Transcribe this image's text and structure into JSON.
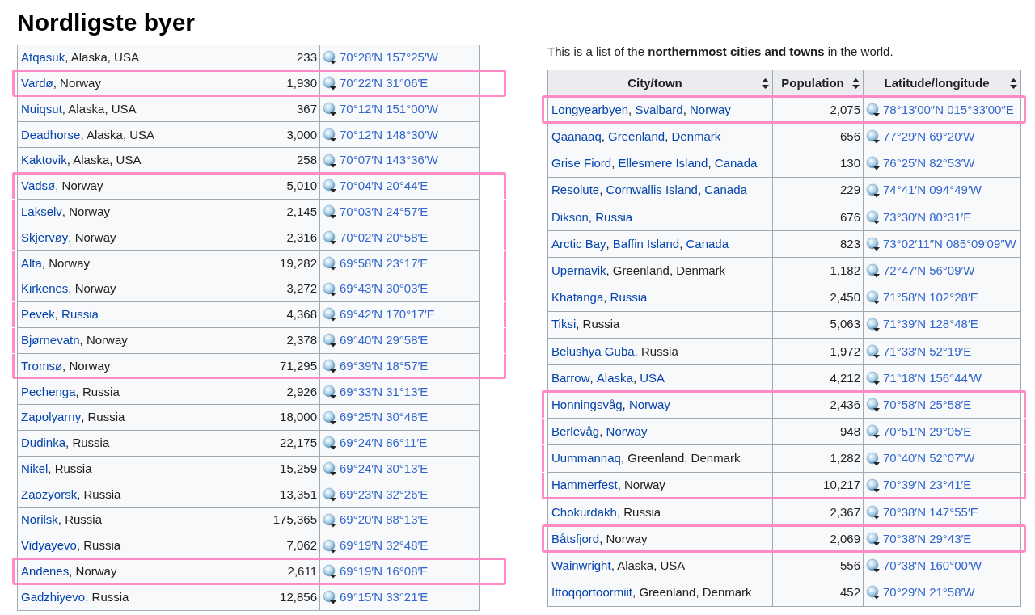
{
  "title": "Nordligste byer",
  "intro": "This is a list of the **northernmost cities and towns** in the world.",
  "tables": [
    {
      "rows": [
        {
          "place": [
            {
              "text": "Atqasuk",
              "link": true
            },
            {
              "text": ", Alaska, USA",
              "link": false
            }
          ],
          "population": "233",
          "coordinates": "70°28′N 157°25′W",
          "highlighted": false
        },
        {
          "place": [
            {
              "text": "Vardø",
              "link": true
            },
            {
              "text": ", Norway",
              "link": false
            }
          ],
          "population": "1,930",
          "coordinates": "70°22′N 31°06′E",
          "highlighted": true
        },
        {
          "place": [
            {
              "text": "Nuiqsut",
              "link": true
            },
            {
              "text": ", Alaska, USA",
              "link": false
            }
          ],
          "population": "367",
          "coordinates": "70°12′N 151°00′W",
          "highlighted": false
        },
        {
          "place": [
            {
              "text": "Deadhorse",
              "link": true
            },
            {
              "text": ", Alaska, USA",
              "link": false
            }
          ],
          "population": "3,000",
          "coordinates": "70°12′N 148°30′W",
          "highlighted": false
        },
        {
          "place": [
            {
              "text": "Kaktovik",
              "link": true
            },
            {
              "text": ", Alaska, USA",
              "link": false
            }
          ],
          "population": "258",
          "coordinates": "70°07′N 143°36′W",
          "highlighted": false
        },
        {
          "place": [
            {
              "text": "Vadsø",
              "link": true
            },
            {
              "text": ", Norway",
              "link": false
            }
          ],
          "population": "5,010",
          "coordinates": "70°04′N 20°44′E",
          "highlighted": true
        },
        {
          "place": [
            {
              "text": "Lakselv",
              "link": true
            },
            {
              "text": ", Norway",
              "link": false
            }
          ],
          "population": "2,145",
          "coordinates": "70°03′N 24°57′E",
          "highlighted": true
        },
        {
          "place": [
            {
              "text": "Skjervøy",
              "link": true
            },
            {
              "text": ", Norway",
              "link": false
            }
          ],
          "population": "2,316",
          "coordinates": "70°02′N 20°58′E",
          "highlighted": true
        },
        {
          "place": [
            {
              "text": "Alta",
              "link": true
            },
            {
              "text": ", Norway",
              "link": false
            }
          ],
          "population": "19,282",
          "coordinates": "69°58′N 23°17′E",
          "highlighted": true
        },
        {
          "place": [
            {
              "text": "Kirkenes",
              "link": true
            },
            {
              "text": ", Norway",
              "link": false
            }
          ],
          "population": "3,272",
          "coordinates": "69°43′N 30°03′E",
          "highlighted": true
        },
        {
          "place": [
            {
              "text": "Pevek",
              "link": true
            },
            {
              "text": ", ",
              "link": false
            },
            {
              "text": "Russia",
              "link": true
            }
          ],
          "population": "4,368",
          "coordinates": "69°42′N 170°17′E",
          "highlighted": true
        },
        {
          "place": [
            {
              "text": "Bjørnevatn",
              "link": true
            },
            {
              "text": ", Norway",
              "link": false
            }
          ],
          "population": "2,378",
          "coordinates": "69°40′N 29°58′E",
          "highlighted": true
        },
        {
          "place": [
            {
              "text": "Tromsø",
              "link": true
            },
            {
              "text": ", Norway",
              "link": false
            }
          ],
          "population": "71,295",
          "coordinates": "69°39′N 18°57′E",
          "highlighted": true
        },
        {
          "place": [
            {
              "text": "Pechenga",
              "link": true
            },
            {
              "text": ", Russia",
              "link": false
            }
          ],
          "population": "2,926",
          "coordinates": "69°33′N 31°13′E",
          "highlighted": false
        },
        {
          "place": [
            {
              "text": "Zapolyarny",
              "link": true
            },
            {
              "text": ", Russia",
              "link": false
            }
          ],
          "population": "18,000",
          "coordinates": "69°25′N 30°48′E",
          "highlighted": false
        },
        {
          "place": [
            {
              "text": "Dudinka",
              "link": true
            },
            {
              "text": ", Russia",
              "link": false
            }
          ],
          "population": "22,175",
          "coordinates": "69°24′N 86°11′E",
          "highlighted": false
        },
        {
          "place": [
            {
              "text": "Nikel",
              "link": true
            },
            {
              "text": ", Russia",
              "link": false
            }
          ],
          "population": "15,259",
          "coordinates": "69°24′N 30°13′E",
          "highlighted": false
        },
        {
          "place": [
            {
              "text": "Zaozyorsk",
              "link": true
            },
            {
              "text": ", Russia",
              "link": false
            }
          ],
          "population": "13,351",
          "coordinates": "69°23′N 32°26′E",
          "highlighted": false
        },
        {
          "place": [
            {
              "text": "Norilsk",
              "link": true
            },
            {
              "text": ", Russia",
              "link": false
            }
          ],
          "population": "175,365",
          "coordinates": "69°20′N 88°13′E",
          "highlighted": false
        },
        {
          "place": [
            {
              "text": "Vidyayevo",
              "link": true
            },
            {
              "text": ", Russia",
              "link": false
            }
          ],
          "population": "7,062",
          "coordinates": "69°19′N 32°48′E",
          "highlighted": false
        },
        {
          "place": [
            {
              "text": "Andenes",
              "link": true
            },
            {
              "text": ", Norway",
              "link": false
            }
          ],
          "population": "2,611",
          "coordinates": "69°19′N 16°08′E",
          "highlighted": true
        },
        {
          "place": [
            {
              "text": "Gadzhiyevo",
              "link": true
            },
            {
              "text": ", Russia",
              "link": false
            }
          ],
          "population": "12,856",
          "coordinates": "69°15′N 33°21′E",
          "highlighted": false
        }
      ]
    },
    {
      "columns": [
        "City/town",
        "Population",
        "Latitude/longitude"
      ],
      "rows": [
        {
          "place": [
            {
              "text": "Longyearbyen",
              "link": true
            },
            {
              "text": ", ",
              "link": false
            },
            {
              "text": "Svalbard",
              "link": true
            },
            {
              "text": ", ",
              "link": false
            },
            {
              "text": "Norway",
              "link": true
            }
          ],
          "population": "2,075",
          "coordinates": "78°13′00″N 015°33′00″E",
          "highlighted": true
        },
        {
          "place": [
            {
              "text": "Qaanaaq",
              "link": true
            },
            {
              "text": ", ",
              "link": false
            },
            {
              "text": "Greenland",
              "link": true
            },
            {
              "text": ", ",
              "link": false
            },
            {
              "text": "Denmark",
              "link": true
            }
          ],
          "population": "656",
          "coordinates": "77°29′N 69°20′W",
          "highlighted": false
        },
        {
          "place": [
            {
              "text": "Grise Fiord",
              "link": true
            },
            {
              "text": ", ",
              "link": false
            },
            {
              "text": "Ellesmere Island",
              "link": true
            },
            {
              "text": ", ",
              "link": false
            },
            {
              "text": "Canada",
              "link": true
            }
          ],
          "population": "130",
          "coordinates": "76°25′N 82°53′W",
          "highlighted": false
        },
        {
          "place": [
            {
              "text": "Resolute",
              "link": true
            },
            {
              "text": ", ",
              "link": false
            },
            {
              "text": "Cornwallis Island",
              "link": true
            },
            {
              "text": ", ",
              "link": false
            },
            {
              "text": "Canada",
              "link": true
            }
          ],
          "population": "229",
          "coordinates": "74°41′N 094°49′W",
          "highlighted": false
        },
        {
          "place": [
            {
              "text": "Dikson",
              "link": true
            },
            {
              "text": ", ",
              "link": false
            },
            {
              "text": "Russia",
              "link": true
            }
          ],
          "population": "676",
          "coordinates": "73°30′N 80°31′E",
          "highlighted": false
        },
        {
          "place": [
            {
              "text": "Arctic Bay",
              "link": true
            },
            {
              "text": ", ",
              "link": false
            },
            {
              "text": "Baffin Island",
              "link": true
            },
            {
              "text": ", ",
              "link": false
            },
            {
              "text": "Canada",
              "link": true
            }
          ],
          "population": "823",
          "coordinates": "73°02′11″N 085°09′09″W",
          "highlighted": false
        },
        {
          "place": [
            {
              "text": "Upernavik",
              "link": true
            },
            {
              "text": ", Greenland, Denmark",
              "link": false
            }
          ],
          "population": "1,182",
          "coordinates": "72°47′N 56°09′W",
          "highlighted": false
        },
        {
          "place": [
            {
              "text": "Khatanga",
              "link": true
            },
            {
              "text": ", ",
              "link": false
            },
            {
              "text": "Russia",
              "link": true
            }
          ],
          "population": "2,450",
          "coordinates": "71°58′N 102°28′E",
          "highlighted": false
        },
        {
          "place": [
            {
              "text": "Tiksi",
              "link": true
            },
            {
              "text": ", Russia",
              "link": false
            }
          ],
          "population": "5,063",
          "coordinates": "71°39′N 128°48′E",
          "highlighted": false
        },
        {
          "place": [
            {
              "text": "Belushya Guba",
              "link": true
            },
            {
              "text": ", Russia",
              "link": false
            }
          ],
          "population": "1,972",
          "coordinates": "71°33′N 52°19′E",
          "highlighted": false
        },
        {
          "place": [
            {
              "text": "Barrow",
              "link": true
            },
            {
              "text": ", ",
              "link": false
            },
            {
              "text": "Alaska",
              "link": true
            },
            {
              "text": ", ",
              "link": false
            },
            {
              "text": "USA",
              "link": true
            }
          ],
          "population": "4,212",
          "coordinates": "71°18′N 156°44′W",
          "highlighted": false
        },
        {
          "place": [
            {
              "text": "Honningsvåg",
              "link": true
            },
            {
              "text": ", ",
              "link": false
            },
            {
              "text": "Norway",
              "link": true
            }
          ],
          "population": "2,436",
          "coordinates": "70°58′N 25°58′E",
          "highlighted": true
        },
        {
          "place": [
            {
              "text": "Berlevåg",
              "link": true
            },
            {
              "text": ", ",
              "link": false
            },
            {
              "text": "Norway",
              "link": true
            }
          ],
          "population": "948",
          "coordinates": "70°51′N 29°05′E",
          "highlighted": true
        },
        {
          "place": [
            {
              "text": "Uummannaq",
              "link": true
            },
            {
              "text": ", Greenland, Denmark",
              "link": false
            }
          ],
          "population": "1,282",
          "coordinates": "70°40′N 52°07′W",
          "highlighted": true
        },
        {
          "place": [
            {
              "text": "Hammerfest",
              "link": true
            },
            {
              "text": ", Norway",
              "link": false
            }
          ],
          "population": "10,217",
          "coordinates": "70°39′N 23°41′E",
          "highlighted": true
        },
        {
          "place": [
            {
              "text": "Chokurdakh",
              "link": true
            },
            {
              "text": ", Russia",
              "link": false
            }
          ],
          "population": "2,367",
          "coordinates": "70°38′N 147°55′E",
          "highlighted": false
        },
        {
          "place": [
            {
              "text": "Båtsfjord",
              "link": true
            },
            {
              "text": ", Norway",
              "link": false
            }
          ],
          "population": "2,069",
          "coordinates": "70°38′N 29°43′E",
          "highlighted": true
        },
        {
          "place": [
            {
              "text": "Wainwright",
              "link": true
            },
            {
              "text": ", Alaska, USA",
              "link": false
            }
          ],
          "population": "556",
          "coordinates": "70°38′N 160°00′W",
          "highlighted": false
        },
        {
          "place": [
            {
              "text": "Ittoqqortoormiit",
              "link": true
            },
            {
              "text": ", Greenland, Denmark",
              "link": false
            }
          ],
          "population": "452",
          "coordinates": "70°29′N 21°58′W",
          "highlighted": false
        }
      ]
    }
  ]
}
